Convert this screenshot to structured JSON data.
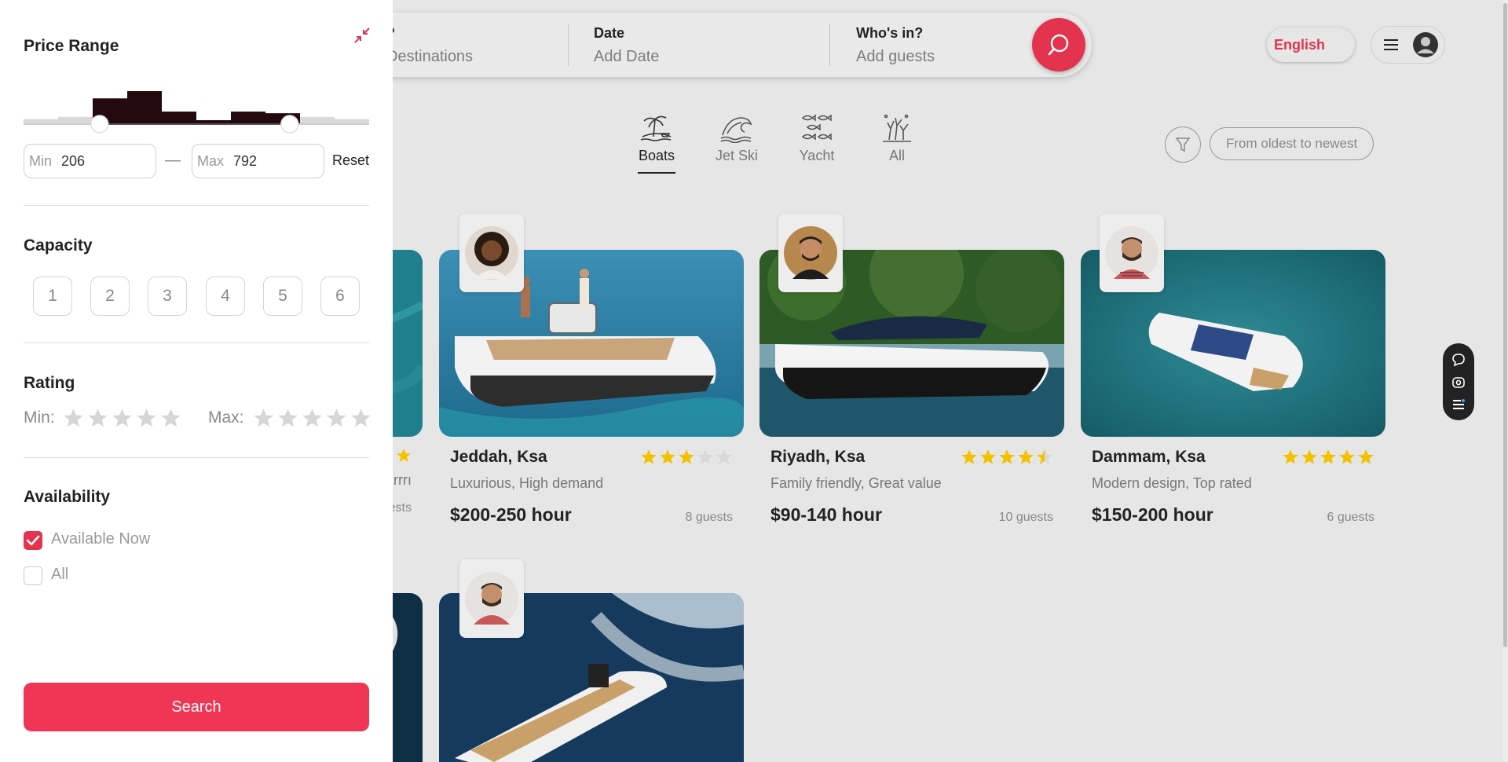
{
  "search": {
    "where_title": "?",
    "where_placeholder": "Destinations",
    "date_title": "Date",
    "date_placeholder": "Add Date",
    "who_title": "Who's in?",
    "who_placeholder": "Add guests",
    "button_icon": "search-icon"
  },
  "header": {
    "language": "English",
    "menu_icon": "hamburger-icon",
    "avatar_icon": "user-avatar-icon"
  },
  "categories": [
    {
      "label": "Boats",
      "icon": "island-boat-icon",
      "active": true
    },
    {
      "label": "Jet Ski",
      "icon": "wave-icon",
      "active": false
    },
    {
      "label": "Yacht",
      "icon": "fish-icon",
      "active": false
    },
    {
      "label": "All",
      "icon": "coral-icon",
      "active": false
    }
  ],
  "sort": {
    "filter_icon": "filter-funnel-icon",
    "label": "From oldest to newest"
  },
  "cards": [
    {
      "location": "Jeddah, Ksa",
      "rating": 3,
      "description": "Luxurious, High demand",
      "price": "$200-250 hour",
      "guests": "8 guests"
    },
    {
      "location": "Riyadh, Ksa",
      "rating": 4.5,
      "description": "Family friendly, Great value",
      "price": "$90-140 hour",
      "guests": "10 guests"
    },
    {
      "location": "Dammam, Ksa",
      "rating": 5,
      "description": "Modern design, Top rated",
      "price": "$150-200 hour",
      "guests": "6 guests"
    }
  ],
  "partial_card": {
    "description_fragment": "rrrı",
    "guests_fragment": "ests"
  },
  "side_tools": [
    "chat-icon",
    "eye-icon",
    "list-icon"
  ],
  "filters": {
    "price_range": {
      "title": "Price Range",
      "collapse_icon": "collapse-arrows-icon",
      "min_label": "Min",
      "min_value": "206",
      "separator": "—",
      "max_label": "Max",
      "max_value": "792",
      "reset_label": "Reset",
      "histogram": [
        0.15,
        0.22,
        0.78,
        1.0,
        0.38,
        0.12,
        0.38,
        0.33,
        0.22,
        0.15
      ],
      "selected_range_fraction": [
        0.22,
        0.77
      ]
    },
    "capacity": {
      "title": "Capacity",
      "options": [
        "1",
        "2",
        "3",
        "4",
        "5",
        "6"
      ]
    },
    "rating": {
      "title": "Rating",
      "min_label": "Min:",
      "max_label": "Max:"
    },
    "availability": {
      "title": "Availability",
      "options": [
        {
          "label": "Available Now",
          "checked": true
        },
        {
          "label": "All",
          "checked": false
        }
      ]
    },
    "search_label": "Search"
  },
  "colors": {
    "brand_red": "#e3334f",
    "star_gold": "#f2c200",
    "histogram_dark": "#240a0f"
  }
}
